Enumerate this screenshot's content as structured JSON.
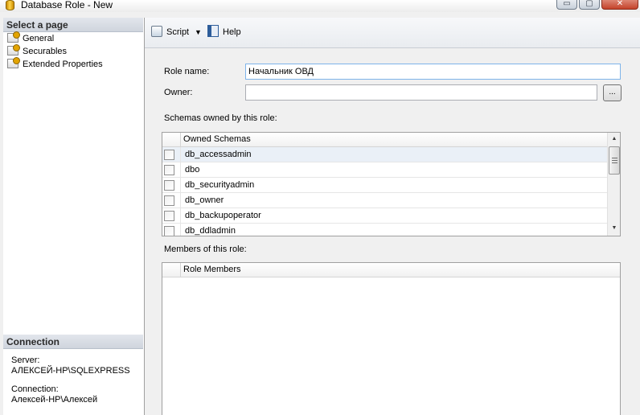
{
  "window": {
    "title": "Database Role - New",
    "minimize_glyph": "▭",
    "maximize_glyph": "▢",
    "close_glyph": "✕"
  },
  "left_panel": {
    "select_page_header": "Select a page",
    "pages": [
      {
        "label": "General",
        "icon": "page-wrench-icon"
      },
      {
        "label": "Securables",
        "icon": "page-wrench-icon"
      },
      {
        "label": "Extended Properties",
        "icon": "page-wrench-icon"
      }
    ],
    "connection_header": "Connection",
    "server_label": "Server:",
    "server_value": "АЛЕКСЕЙ-HP\\SQLEXPRESS",
    "connection_label": "Connection:",
    "connection_value": "Алексей-HP\\Алексей"
  },
  "toolbar": {
    "script_label": "Script",
    "script_dropdown_glyph": "▼",
    "help_label": "Help"
  },
  "form": {
    "role_name_label": "Role name:",
    "role_name_value": "Начальник ОВД",
    "owner_label": "Owner:",
    "owner_value": "",
    "browse_label": "...",
    "schemas_label": "Schemas owned by this role:",
    "schemas_header": "Owned Schemas",
    "schemas": [
      {
        "name": "db_accessadmin",
        "checked": false,
        "selected": true
      },
      {
        "name": "dbo",
        "checked": false,
        "selected": false
      },
      {
        "name": "db_securityadmin",
        "checked": false,
        "selected": false
      },
      {
        "name": "db_owner",
        "checked": false,
        "selected": false
      },
      {
        "name": "db_backupoperator",
        "checked": false,
        "selected": false
      },
      {
        "name": "db_ddladmin",
        "checked": false,
        "selected": false
      }
    ],
    "members_label": "Members of this role:",
    "members_header": "Role Members",
    "members": []
  },
  "scrollbar": {
    "up_glyph": "▲",
    "down_glyph": "▼"
  }
}
